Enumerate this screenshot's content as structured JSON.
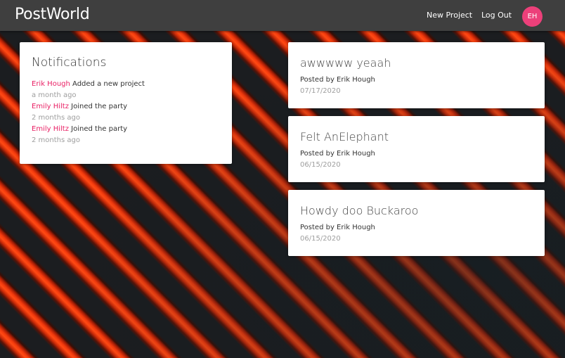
{
  "navbar": {
    "brand": "PostWorld",
    "new_project_label": "New Project",
    "logout_label": "Log Out",
    "avatar_initials": "EH",
    "avatar_color": "#ec407a"
  },
  "notifications": {
    "title": "Notifications",
    "items": [
      {
        "user": "Erik Hough",
        "action": "Added a new project",
        "time": "a month ago"
      },
      {
        "user": "Emily Hiltz",
        "action": "Joined the party",
        "time": "2 months ago"
      },
      {
        "user": "Emily Hiltz",
        "action": "Joined the party",
        "time": "2 months ago"
      }
    ]
  },
  "posts": [
    {
      "title": "awwwww yeaah",
      "author": "Posted by Erik Hough",
      "date": "07/17/2020"
    },
    {
      "title": "Felt AnElephant",
      "author": "Posted by Erik Hough",
      "date": "06/15/2020"
    },
    {
      "title": "Howdy doo Buckaroo",
      "author": "Posted by Erik Hough",
      "date": "06/15/2020"
    }
  ],
  "colors": {
    "accent": "#e91e63",
    "navbar": "#3f3f3f",
    "muted_text": "#9e9e9e"
  }
}
